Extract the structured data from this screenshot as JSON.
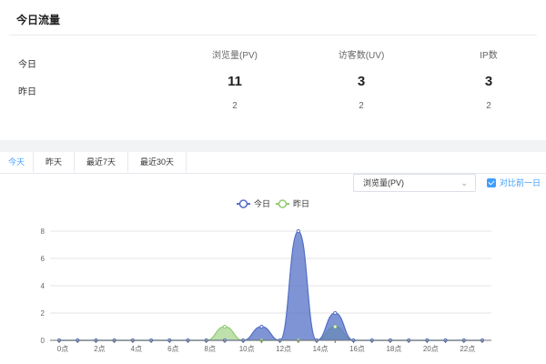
{
  "summary": {
    "title": "今日流量",
    "rows": [
      "今日",
      "昨日"
    ],
    "columns": [
      {
        "header": "浏览量(PV)",
        "today": "11",
        "yesterday": "2"
      },
      {
        "header": "访客数(UV)",
        "today": "3",
        "yesterday": "2"
      },
      {
        "header": "IP数",
        "today": "3",
        "yesterday": "2"
      }
    ]
  },
  "tabs": [
    "今天",
    "昨天",
    "最近7天",
    "最近30天"
  ],
  "metric_select": {
    "value": "浏览量(PV)"
  },
  "compare_checkbox": {
    "label": "对比前一日",
    "checked": true
  },
  "colors": {
    "accent": "#409eff",
    "today": "#5470c6",
    "yesterday": "#91cc75"
  },
  "chart_data": {
    "type": "area",
    "legend": [
      "今日",
      "昨日"
    ],
    "x": [
      0,
      1,
      2,
      3,
      4,
      5,
      6,
      7,
      8,
      9,
      10,
      11,
      12,
      13,
      14,
      15,
      16,
      17,
      18,
      19,
      20,
      21,
      22,
      23
    ],
    "x_tick_labels": [
      "0点",
      "2点",
      "4点",
      "6点",
      "8点",
      "10点",
      "12点",
      "14点",
      "16点",
      "18点",
      "20点",
      "22点"
    ],
    "y_ticks": [
      0,
      2,
      4,
      6,
      8
    ],
    "ylim": [
      0,
      8
    ],
    "series": [
      {
        "name": "今日",
        "values": [
          0,
          0,
          0,
          0,
          0,
          0,
          0,
          0,
          0,
          0,
          0,
          1,
          0,
          8,
          0,
          2,
          0,
          0,
          0,
          0,
          0,
          0,
          0,
          0
        ]
      },
      {
        "name": "昨日",
        "values": [
          0,
          0,
          0,
          0,
          0,
          0,
          0,
          0,
          0,
          1,
          0,
          0,
          0,
          0,
          0,
          1,
          0,
          0,
          0,
          0,
          0,
          0,
          0,
          0
        ]
      }
    ]
  }
}
